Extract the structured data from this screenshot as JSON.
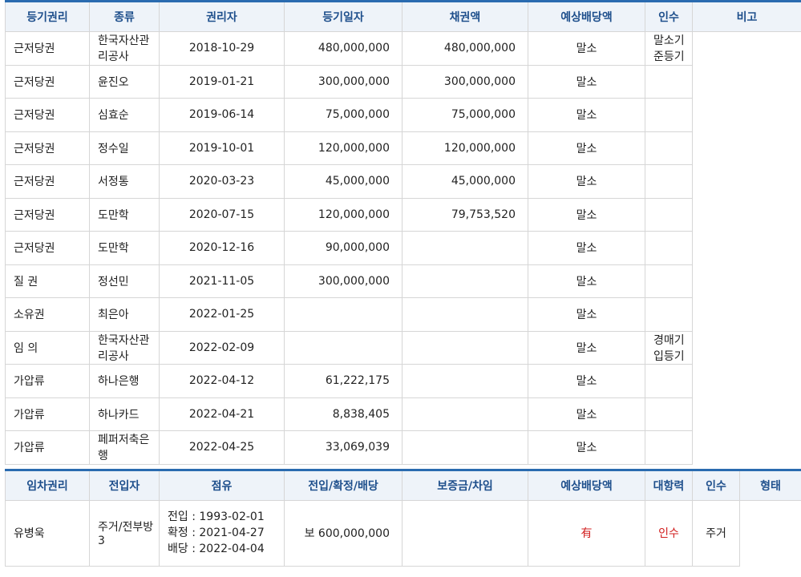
{
  "registered": {
    "section_label": "등기권리",
    "headers": [
      "종류",
      "권리자",
      "등기일자",
      "채권액",
      "예상배당액",
      "인수",
      "비고"
    ],
    "rows": [
      {
        "kind": "근저당권",
        "holder": "한국자산관리공사",
        "date": "2018-10-29",
        "claim": "480,000,000",
        "dividend": "480,000,000",
        "takeover": "말소",
        "note": "말소기준등기"
      },
      {
        "kind": "근저당권",
        "holder": "윤진오",
        "date": "2019-01-21",
        "claim": "300,000,000",
        "dividend": "300,000,000",
        "takeover": "말소",
        "note": ""
      },
      {
        "kind": "근저당권",
        "holder": "심효순",
        "date": "2019-06-14",
        "claim": "75,000,000",
        "dividend": "75,000,000",
        "takeover": "말소",
        "note": ""
      },
      {
        "kind": "근저당권",
        "holder": "정수일",
        "date": "2019-10-01",
        "claim": "120,000,000",
        "dividend": "120,000,000",
        "takeover": "말소",
        "note": ""
      },
      {
        "kind": "근저당권",
        "holder": "서정통",
        "date": "2020-03-23",
        "claim": "45,000,000",
        "dividend": "45,000,000",
        "takeover": "말소",
        "note": ""
      },
      {
        "kind": "근저당권",
        "holder": "도만학",
        "date": "2020-07-15",
        "claim": "120,000,000",
        "dividend": "79,753,520",
        "takeover": "말소",
        "note": ""
      },
      {
        "kind": "근저당권",
        "holder": "도만학",
        "date": "2020-12-16",
        "claim": "90,000,000",
        "dividend": "",
        "takeover": "말소",
        "note": ""
      },
      {
        "kind": "질 권",
        "holder": "정선민",
        "date": "2021-11-05",
        "claim": "300,000,000",
        "dividend": "",
        "takeover": "말소",
        "note": ""
      },
      {
        "kind": "소유권",
        "holder": "최은아",
        "date": "2022-01-25",
        "claim": "",
        "dividend": "",
        "takeover": "말소",
        "note": ""
      },
      {
        "kind": "임 의",
        "holder": "한국자산관리공사",
        "date": "2022-02-09",
        "claim": "",
        "dividend": "",
        "takeover": "말소",
        "note": "경매기입등기"
      },
      {
        "kind": "가압류",
        "holder": "하나은행",
        "date": "2022-04-12",
        "claim": "61,222,175",
        "dividend": "",
        "takeover": "말소",
        "note": ""
      },
      {
        "kind": "가압류",
        "holder": "하나카드",
        "date": "2022-04-21",
        "claim": "8,838,405",
        "dividend": "",
        "takeover": "말소",
        "note": ""
      },
      {
        "kind": "가압류",
        "holder": "페퍼저축은행",
        "date": "2022-04-25",
        "claim": "33,069,039",
        "dividend": "",
        "takeover": "말소",
        "note": ""
      }
    ]
  },
  "lease": {
    "section_label": "임차권리",
    "headers": [
      "전입자",
      "점유",
      "전입/확정/배당",
      "보증금/차임",
      "예상배당액",
      "대항력",
      "인수",
      "형태"
    ],
    "rows": [
      {
        "tenant": "유병욱",
        "occupancy": "주거/전부방3",
        "move_in": "전입 : 1993-02-01",
        "fixed": "확정 : 2021-04-27",
        "dividend_req": "배당 : 2022-04-04",
        "deposit": "보 600,000,000",
        "expected_dividend": "",
        "opposing_power": "有",
        "takeover": "인수",
        "type": "주거"
      }
    ]
  },
  "colors": {
    "accent": "#2a6bb0",
    "header_bg": "#eef3f9",
    "header_text": "#1e4f8c",
    "border": "#d6d6d6",
    "alert": "#d21f1f"
  }
}
